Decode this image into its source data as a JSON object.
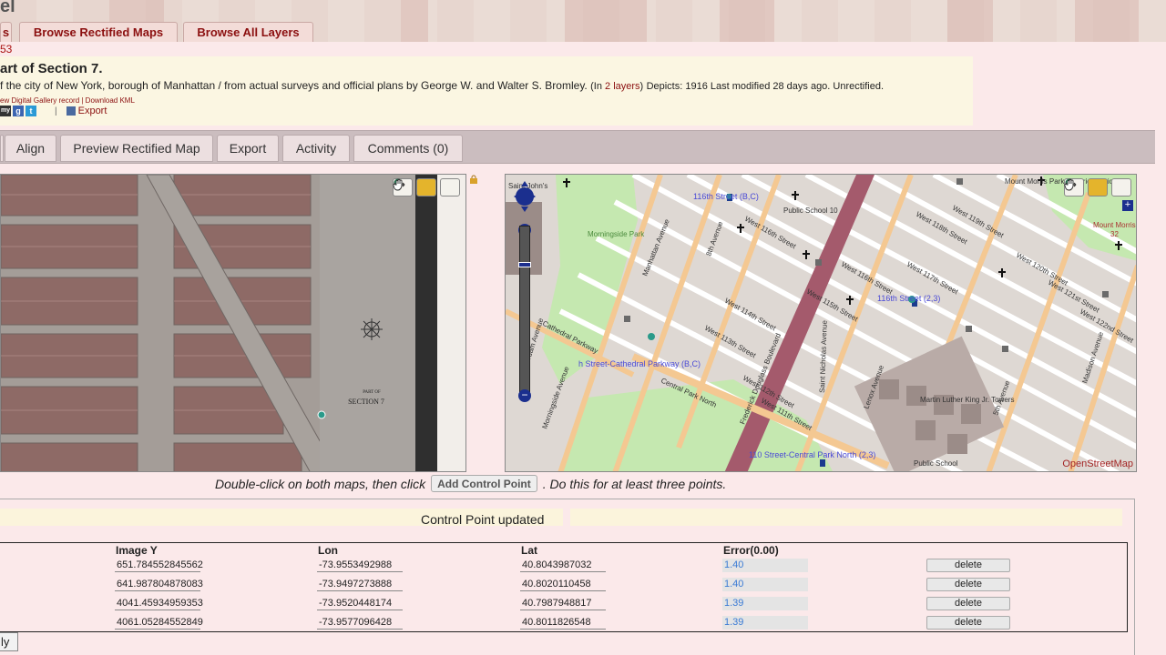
{
  "header": {
    "logo_fragment": "el",
    "tabs": [
      "s",
      "Browse Rectified Maps",
      "Browse All Layers"
    ],
    "sub_number": "53"
  },
  "map_info": {
    "title": "art of Section 7.",
    "description": "f the city of New York, borough of Manhattan / from actual surveys and official plans by George W. and Walter S. Bromley.",
    "layers_prefix": "(In ",
    "layers_link": "2 layers",
    "layers_suffix": ")",
    "meta": "Depicts: 1916 Last modified 28 days ago. Unrectified.",
    "small_links": "ew Digital Gallery record | Download KML",
    "share_label": "my",
    "export_label": "Export"
  },
  "tabs": [
    "",
    "Align",
    "Preview Rectified Map",
    "Export",
    "Activity",
    "Comments (0)"
  ],
  "left_map": {
    "label_line1": "PART OF",
    "label_line2": "SECTION 7"
  },
  "right_map": {
    "credit": "OpenStreetMap",
    "labels": {
      "morningside": "Morningside Park",
      "station_116": "116th Street (B,C)",
      "station_116_23": "116th Street (2,3)",
      "cathedral": "h Street-Cathedral Parkway (B,C)",
      "station_110": "110 Street-Central Park North (2,3)",
      "west_116": "West 116th Street",
      "west_114": "West 114th Street",
      "west_113": "West 113th Street",
      "west_112": "West 112th Street",
      "west_111": "West 111th Street",
      "west_115": "West 115th Street",
      "west_117": "West 117th Street",
      "west_118": "West 118th Street",
      "west_119": "West 119th Street",
      "west_120": "West 120th Street",
      "west_121": "West 121st Street",
      "west_122": "West 122nd Street",
      "west_116b": "West 116th Street",
      "central_park_north": "Central Park North",
      "cathedral_parkway": "Cathedral Parkway",
      "morningside_ave": "Morningside Avenue",
      "manhattan_ave": "Manhattan Avenue",
      "eighth_ave": "8th Avenue",
      "st_nicholas": "Saint Nicholas Avenue",
      "lenox": "Lenox Avenue",
      "fifth_ave": "5th Avenue",
      "madison_ave": "Madison Avenue",
      "frederick_douglass": "Frederick Douglass Boulevard",
      "amsterdam": "Amsterdam Avenue",
      "mount_morris_park": "Mount Morris Park Historic District",
      "public_school_10": "Public School 10",
      "mlk_towers": "Martin Luther King Jr. Towers",
      "public_school": "Public School",
      "mount_morris": "Mount Morris",
      "mount_morris_num": "32",
      "saint_john": "Saint John's"
    }
  },
  "instruction": {
    "before": "Double-click on both maps, then click",
    "button": "Add Control Point",
    "after": ". Do this for at least three points."
  },
  "control_points": {
    "status": "Control Point updated",
    "headers": {
      "image_y": "Image Y",
      "lon": "Lon",
      "lat": "Lat",
      "error": "Error(0.00)"
    },
    "rows": [
      {
        "image_y": "651.784552845562",
        "lon": "-73.9553492988",
        "lat": "40.8043987032",
        "error": "1.40",
        "action": "delete"
      },
      {
        "image_y": "641.987804878083",
        "lon": "-73.9497273888",
        "lat": "40.8020110458",
        "error": "1.40",
        "action": "delete"
      },
      {
        "image_y": "4041.45934959353",
        "lon": "-73.9520448174",
        "lat": "40.7987948817",
        "error": "1.39",
        "action": "delete"
      },
      {
        "image_y": "4061.05284552849",
        "lon": "-73.9577096428",
        "lat": "40.8011826548",
        "error": "1.39",
        "action": "delete"
      }
    ],
    "apply_label": "ly"
  },
  "colors": {
    "accent_red": "#8b0f0f",
    "page_bg": "#fbe9ea",
    "info_bg": "#fbf6e2",
    "tool_active": "#e4b42c",
    "subway_blue": "#1b2f8e"
  }
}
